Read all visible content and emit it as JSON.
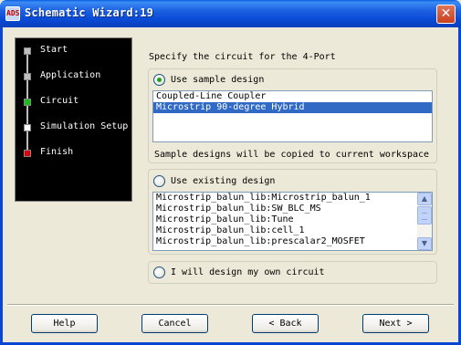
{
  "window": {
    "title": "Schematic Wizard:19",
    "icon_text": "ADS",
    "close_glyph": "✕"
  },
  "steps": [
    {
      "label": "Start",
      "marker_color": "#bfbfbf"
    },
    {
      "label": "Application",
      "marker_color": "#bfbfbf"
    },
    {
      "label": "Circuit",
      "marker_color": "#17c017"
    },
    {
      "label": "Simulation Setup",
      "marker_color": "#ffffff"
    },
    {
      "label": "Finish",
      "marker_color": "#e00000"
    }
  ],
  "main": {
    "instruction": "Specify the circuit for the 4-Port",
    "sample": {
      "label": "Use sample design",
      "checked": true,
      "items": [
        "Coupled-Line Coupler",
        "Microstrip 90-degree Hybrid"
      ],
      "selected_index": 1,
      "note": "Sample designs will be copied to current workspace"
    },
    "existing": {
      "label": "Use existing design",
      "checked": false,
      "items": [
        "Microstrip_balun_lib:Microstrip_balun_1",
        "Microstrip_balun_lib:SW_BLC_MS",
        "Microstrip_balun_lib:Tune",
        "Microstrip_balun_lib:cell_1",
        "Microstrip_balun_lib:prescalar2_MOSFET"
      ]
    },
    "own": {
      "label": "I will design my own circuit",
      "checked": false
    }
  },
  "buttons": {
    "help": "Help",
    "cancel": "Cancel",
    "back": "< Back",
    "next": "Next >"
  },
  "scrollbar": {
    "up_glyph": "▲",
    "down_glyph": "▼"
  }
}
